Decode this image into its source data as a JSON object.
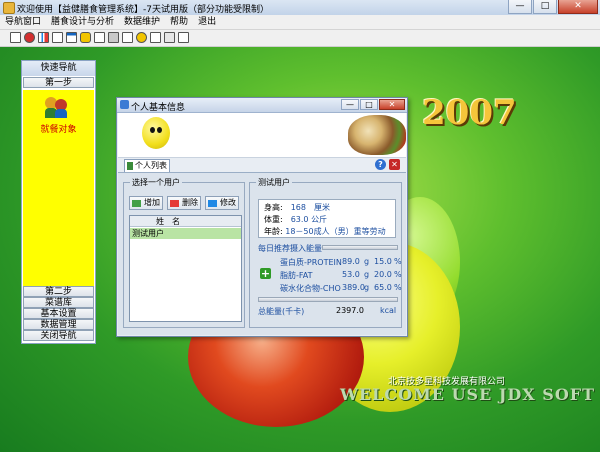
{
  "window": {
    "title": "欢迎使用【益健膳食管理系统】-7天试用版（部分功能受限制）",
    "minimize_label": "—",
    "maximize_label": "□",
    "close_label": "✕"
  },
  "menu": {
    "items": [
      {
        "label": "导航窗口"
      },
      {
        "label": "膳食设计与分析"
      },
      {
        "label": "数据维护"
      },
      {
        "label": "帮助"
      },
      {
        "label": "退出"
      }
    ]
  },
  "toolbar": {
    "icons": [
      "table-icon",
      "stop-icon",
      "chart-icon",
      "chart-line-icon",
      "window-icon",
      "lock-icon",
      "document-icon",
      "print-icon",
      "calendar-icon",
      "help-icon",
      "preview-icon",
      "copy-icon",
      "exit-icon"
    ]
  },
  "nav": {
    "header": "快速导航",
    "step1": "第一步",
    "target_label": "就餐对象",
    "buttons": [
      "第二步",
      "菜谱库",
      "基本设置",
      "数据管理",
      "关闭导航"
    ]
  },
  "desktop": {
    "brand_year": "2007",
    "company": "北京技多星科技发展有限公司",
    "welcome": "WELCOME USE JDX SOFT"
  },
  "dialog": {
    "title": "个人基本信息",
    "tab": "个人列表",
    "select_group": "选择一个用户",
    "add_label": "增加",
    "delete_label": "删除",
    "edit_label": "修改",
    "col_name": "姓　名",
    "users": [
      "测试用户"
    ],
    "test_group": "测试用户",
    "height_label": "身高:",
    "height_value": "168",
    "height_unit": "厘米",
    "weight_label": "体重:",
    "weight_value": "63.0",
    "weight_unit": "公斤",
    "age_label": "年龄:",
    "age_value": "18－50成人（男）重等劳动",
    "intake_title": "每日推荐摄入能量",
    "nutrients": [
      {
        "name": "蛋白质-PROTEIN",
        "value": "89.0",
        "unit": "g",
        "pct": "15.0",
        "pct_unit": "%"
      },
      {
        "name": "脂肪-FAT",
        "value": "53.0",
        "unit": "g",
        "pct": "20.0",
        "pct_unit": "%"
      },
      {
        "name": "碳水化合物-CHO",
        "value": "389.0",
        "unit": "g",
        "pct": "65.0",
        "pct_unit": "%"
      }
    ],
    "total_label": "总能量(千卡)",
    "total_value": "2397.0",
    "total_unit": "kcal"
  },
  "colors": {
    "nav_panel": "#ffff00",
    "selected_row": "#b9e4a4",
    "desktop_green": "#5fbf2e"
  }
}
